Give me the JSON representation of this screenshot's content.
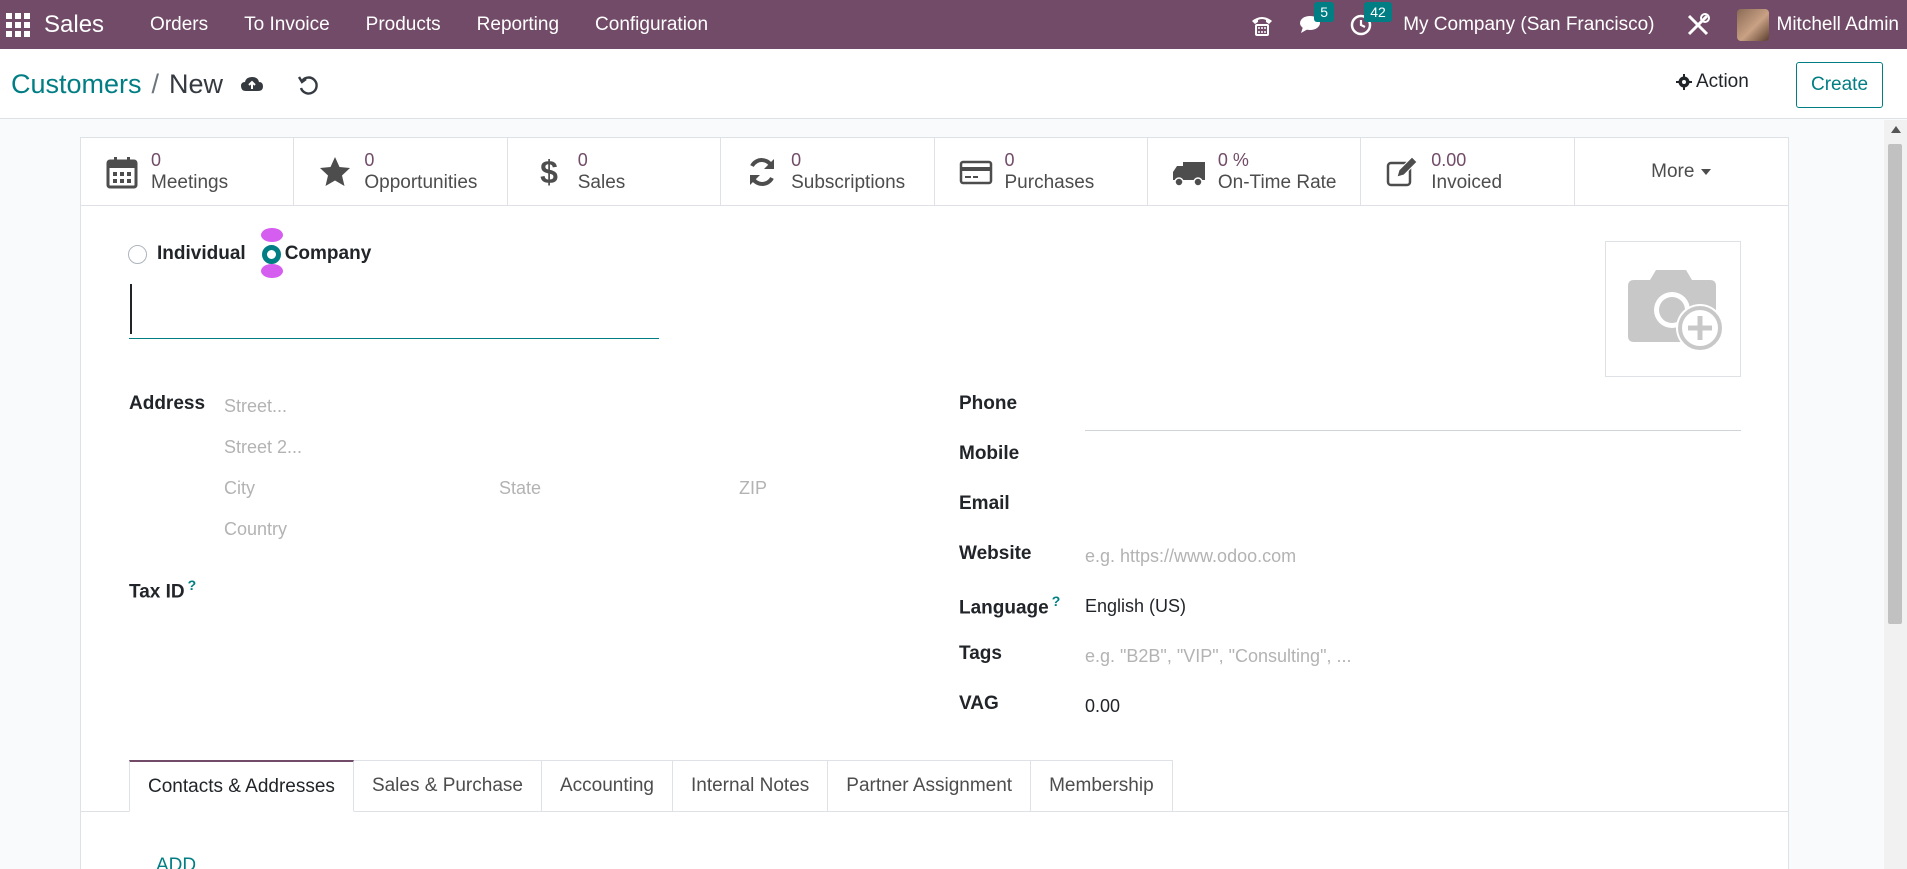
{
  "navbar": {
    "app_name": "Sales",
    "menu": [
      "Orders",
      "To Invoice",
      "Products",
      "Reporting",
      "Configuration"
    ],
    "messages_count": "5",
    "activities_count": "42",
    "company": "My Company (San Francisco)",
    "user": "Mitchell Admin"
  },
  "breadcrumb": {
    "parent": "Customers",
    "separator": "/",
    "current": "New"
  },
  "control": {
    "action_label": "Action",
    "create_label": "Create"
  },
  "smart_buttons": [
    {
      "value": "0",
      "label": "Meetings",
      "icon": "calendar-icon"
    },
    {
      "value": "0",
      "label": "Opportunities",
      "icon": "star-icon"
    },
    {
      "value": "0",
      "label": "Sales",
      "icon": "dollar-icon"
    },
    {
      "value": "0",
      "label": "Subscriptions",
      "icon": "refresh-icon"
    },
    {
      "value": "0",
      "label": "Purchases",
      "icon": "credit-card-icon"
    },
    {
      "value": "0 %",
      "label": "On-Time Rate",
      "icon": "truck-icon"
    },
    {
      "value": "0.00",
      "label": "Invoiced",
      "icon": "pencil-square-icon"
    }
  ],
  "more_label": "More",
  "company_type": {
    "individual": "Individual",
    "company": "Company",
    "selected": "Company"
  },
  "fields": {
    "address_label": "Address",
    "street_ph": "Street...",
    "street2_ph": "Street 2...",
    "city_ph": "City",
    "state_ph": "State",
    "zip_ph": "ZIP",
    "country_ph": "Country",
    "tax_id_label": "Tax ID",
    "help_mark": "?",
    "phone_label": "Phone",
    "mobile_label": "Mobile",
    "email_label": "Email",
    "website_label": "Website",
    "website_ph": "e.g. https://www.odoo.com",
    "language_label": "Language",
    "language_value": "English (US)",
    "tags_label": "Tags",
    "tags_ph": "e.g. \"B2B\", \"VIP\", \"Consulting\", ...",
    "vag_label": "VAG",
    "vag_value": "0.00"
  },
  "tabs": [
    "Contacts & Addresses",
    "Sales & Purchase",
    "Accounting",
    "Internal Notes",
    "Partner Assignment",
    "Membership"
  ],
  "add_label": "ADD",
  "colors": {
    "brand": "#714b67",
    "accent": "#017e84"
  }
}
